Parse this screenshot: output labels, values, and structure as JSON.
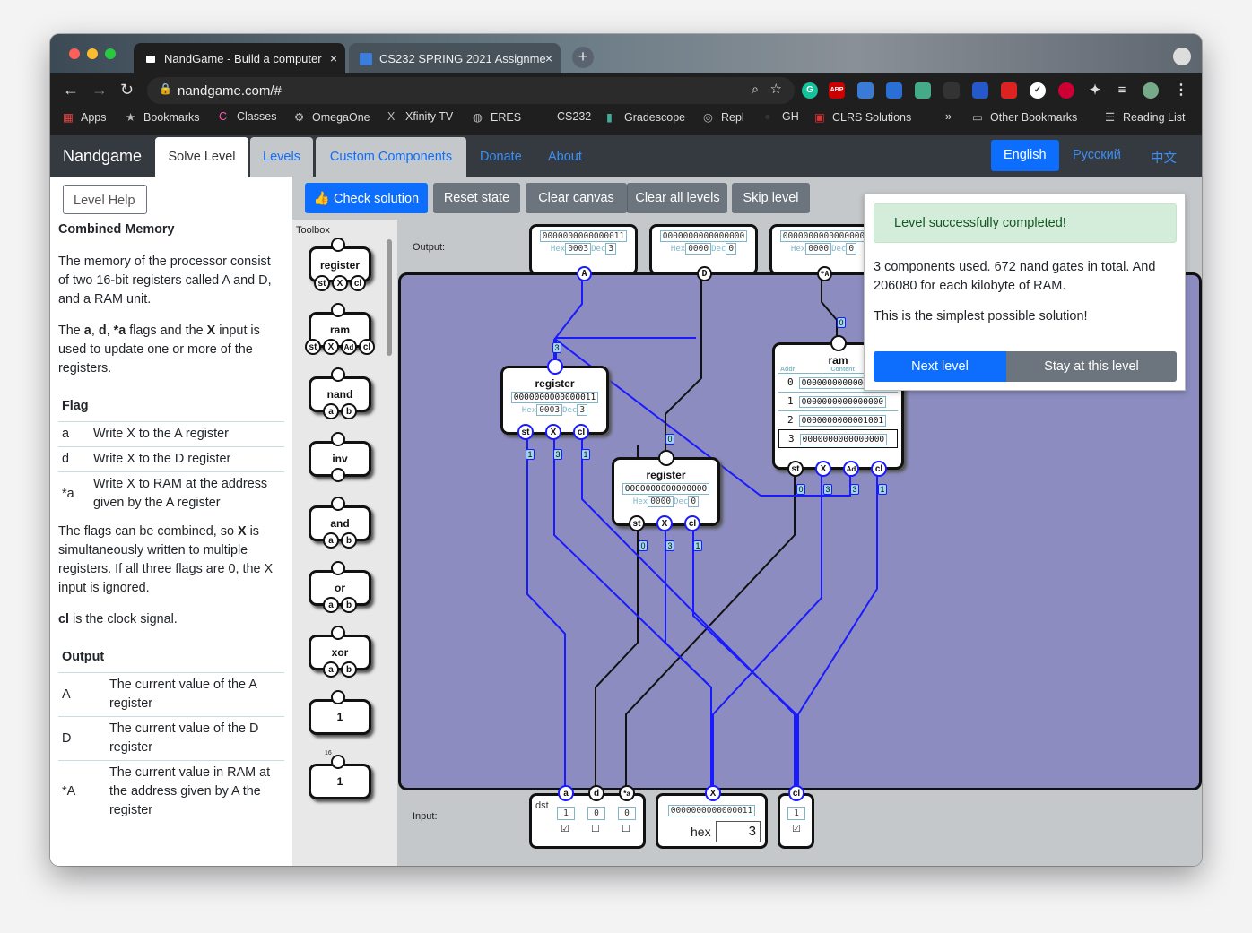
{
  "browser": {
    "tabs": [
      {
        "title": "NandGame - Build a computer"
      },
      {
        "title": "CS232 SPRING 2021 Assignme"
      }
    ],
    "close_glyph": "×",
    "newtab_glyph": "+",
    "url": "nandgame.com/#",
    "bookmarks": [
      "Apps",
      "Bookmarks",
      "Classes",
      "OmegaOne",
      "Xfinity TV",
      "ERES",
      "CS232",
      "Gradescope",
      "Repl",
      "GH",
      "CLRS Solutions"
    ],
    "more_glyph": "»",
    "other_bookmarks": "Other Bookmarks",
    "reading_list": "Reading List"
  },
  "navbar": {
    "brand": "Nandgame",
    "tabs": [
      "Solve Level",
      "Levels",
      "Custom Components"
    ],
    "links": [
      "Donate",
      "About"
    ],
    "languages": [
      "English",
      "Русский",
      "中文"
    ]
  },
  "help": {
    "button": "Level Help",
    "title": "Combined Memory",
    "intro": "The memory of the processor consist of two 16-bit registers called A and D, and a RAM unit.",
    "flags_intro_1": "The ",
    "flags_intro_a": "a",
    "flags_intro_sep1": ", ",
    "flags_intro_d": "d",
    "flags_intro_sep2": ", ",
    "flags_intro_star": "*a",
    "flags_intro_2": " flags and the ",
    "flags_intro_x": "X",
    "flags_intro_3": " input is used to update one or more of the registers.",
    "flag_header": "Flag",
    "flags": [
      {
        "flag": "a",
        "desc": "Write X to the A register"
      },
      {
        "flag": "d",
        "desc": "Write X to the D register"
      },
      {
        "flag": "*a",
        "desc": "Write X to RAM at the address given by the A register"
      }
    ],
    "combine_1": "The flags can be combined, so ",
    "combine_x": "X",
    "combine_2": " is simultaneously written to multiple registers. If all three flags are 0, the X input is ignored.",
    "clock_cl": "cl",
    "clock_rest": " is the clock signal.",
    "output_header": "Output",
    "outputs": [
      {
        "name": "A",
        "desc": "The current value of the A register"
      },
      {
        "name": "D",
        "desc": "The current value of the D register"
      },
      {
        "name": "*A",
        "desc": "The current value in RAM at the address given by A the register"
      }
    ]
  },
  "toolbar": {
    "check": "Check solution",
    "reset": "Reset state",
    "clear_canvas": "Clear canvas",
    "clear_levels": "Clear all levels",
    "skip": "Skip level"
  },
  "toolbox": {
    "header": "Toolbox",
    "items": [
      "register",
      "ram",
      "nand",
      "inv",
      "and",
      "or",
      "xor",
      "1",
      "1"
    ],
    "register_pins": [
      "st",
      "X",
      "cl"
    ],
    "ram_pins": [
      "st",
      "X",
      "Ad",
      "cl"
    ],
    "gate_pins": [
      "a",
      "b"
    ],
    "width_label": "16",
    "info_glyph": "i"
  },
  "canvas": {
    "output_label": "Output:",
    "input_label": "Input:",
    "hex_label": "Hex",
    "dec_label": "Dec",
    "outputs": [
      {
        "pin": "A",
        "bits": "0000000000000011",
        "hex": "0003",
        "dec": "3"
      },
      {
        "pin": "D",
        "bits": "0000000000000000",
        "hex": "0000",
        "dec": "0"
      },
      {
        "pin": "*A",
        "bits": "0000000000000000",
        "hex": "0000",
        "dec": "0"
      }
    ],
    "reg_a": {
      "name": "register",
      "bits": "0000000000000011",
      "hex": "0003",
      "dec": "3",
      "pins": [
        "st",
        "X",
        "cl"
      ],
      "pin_values": [
        "1",
        "3",
        "1"
      ],
      "in_value": "3"
    },
    "reg_d": {
      "name": "register",
      "bits": "0000000000000000",
      "hex": "0000",
      "dec": "0",
      "pins": [
        "st",
        "X",
        "cl"
      ],
      "pin_values": [
        "0",
        "3",
        "1"
      ],
      "in_value": "0"
    },
    "ram": {
      "name": "ram",
      "addr_header": "Addr",
      "content_header": "Content",
      "rows": [
        {
          "addr": "0",
          "bits": "0000000000000000"
        },
        {
          "addr": "1",
          "bits": "0000000000000000"
        },
        {
          "addr": "2",
          "bits": "0000000000001001"
        },
        {
          "addr": "3",
          "bits": "0000000000000000"
        }
      ],
      "pins": [
        "st",
        "X",
        "Ad",
        "cl"
      ],
      "pin_values": [
        "0",
        "3",
        "3",
        "1"
      ],
      "out_value": "0"
    },
    "inputs": {
      "dst_label": "dst",
      "flags": [
        {
          "pin": "a",
          "value": "1",
          "checked": "☑"
        },
        {
          "pin": "d",
          "value": "0",
          "checked": "☐"
        },
        {
          "pin": "*a",
          "value": "0",
          "checked": "☐"
        }
      ],
      "x_pin": "X",
      "x_bits": "0000000000000011",
      "x_hex_label": "hex",
      "x_value": "3",
      "cl_pin": "cl",
      "cl_value": "1",
      "cl_checked": "☑"
    }
  },
  "result": {
    "alert": "Level successfully completed!",
    "stats": "3 components used. 672 nand gates in total. And 206080 for each kilobyte of RAM.",
    "simplest": "This is the simplest possible solution!",
    "next": "Next level",
    "stay": "Stay at this level"
  },
  "colors": {
    "canvas_bg": "#8c8cc0",
    "wire_blue": "#1a1aff",
    "primary": "#0d6efd",
    "navbar": "#343a40"
  }
}
